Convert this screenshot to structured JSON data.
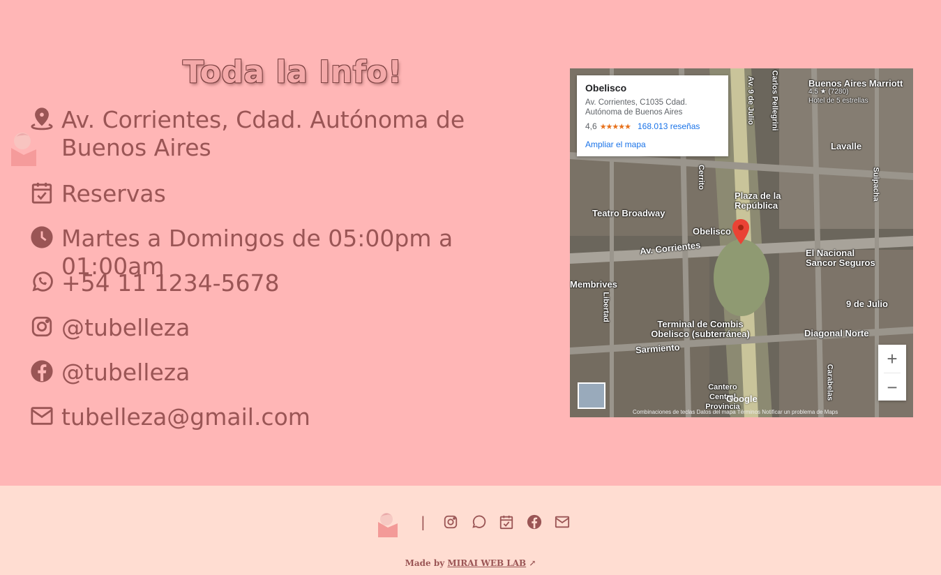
{
  "info": {
    "title": "Toda la Info!",
    "address": "Av. Corrientes, Cdad. Autónoma de Buenos Aires",
    "reservas": "Reservas",
    "hours": "Martes a Domingos de 05:00pm a 01:00am",
    "phone": "+54 11 1234-5678",
    "instagram": "@tubelleza",
    "facebook": "@tubelleza",
    "email": "tubelleza@gmail.com"
  },
  "map": {
    "place": "Obelisco",
    "address": "Av. Corrientes, C1035 Cdad. Autónoma de Buenos Aires",
    "rating": "4,6",
    "stars": "★★★★★",
    "reviews": "168.013 reseñas",
    "expand_link": "Ampliar el mapa",
    "labels": {
      "buenos_aires_marriott": "Buenos Aires Marriott",
      "marriott_rating": "4.5 ★ (7280)",
      "hotel_stars": "Hotel de 5 estrellas",
      "lavalle": "Lavalle",
      "plaza_republica": "Plaza de la República",
      "teatro_broadway": "Teatro Broadway",
      "obelisco": "Obelisco",
      "av_corrientes": "Av. Corrientes",
      "el_nacional": "El Nacional Sancor Seguros",
      "membrives": "Membrives",
      "nueve_de_julio": "9 de Julio",
      "terminal": "Terminal de Combis Obelisco (subterránea)",
      "diagonal_norte": "Diagonal Norte",
      "sarmiento": "Sarmiento",
      "cerrito": "Cerrito",
      "av_9_de_julio": "Av. 9 de Julio",
      "carlos_pellegrini": "Carlos Pellegrini",
      "suipacha": "Suipacha",
      "libertad": "Libertad",
      "carabelas": "Carabelas",
      "cantero": "Cantero Central Provincia"
    },
    "google": "Google",
    "footer_text": "Combinaciones de teclas   Datos del mapa   Términos   Notificar un problema de Maps",
    "zoom_in": "+",
    "zoom_out": "−"
  },
  "footer": {
    "divider": "|",
    "made_by": "Made by",
    "lab": "MIRAI WEB LAB",
    "arrow": "↗"
  },
  "colors": {
    "bg": "#ffb6b6",
    "footer_bg": "#ffddd2",
    "text": "#9a5555"
  }
}
